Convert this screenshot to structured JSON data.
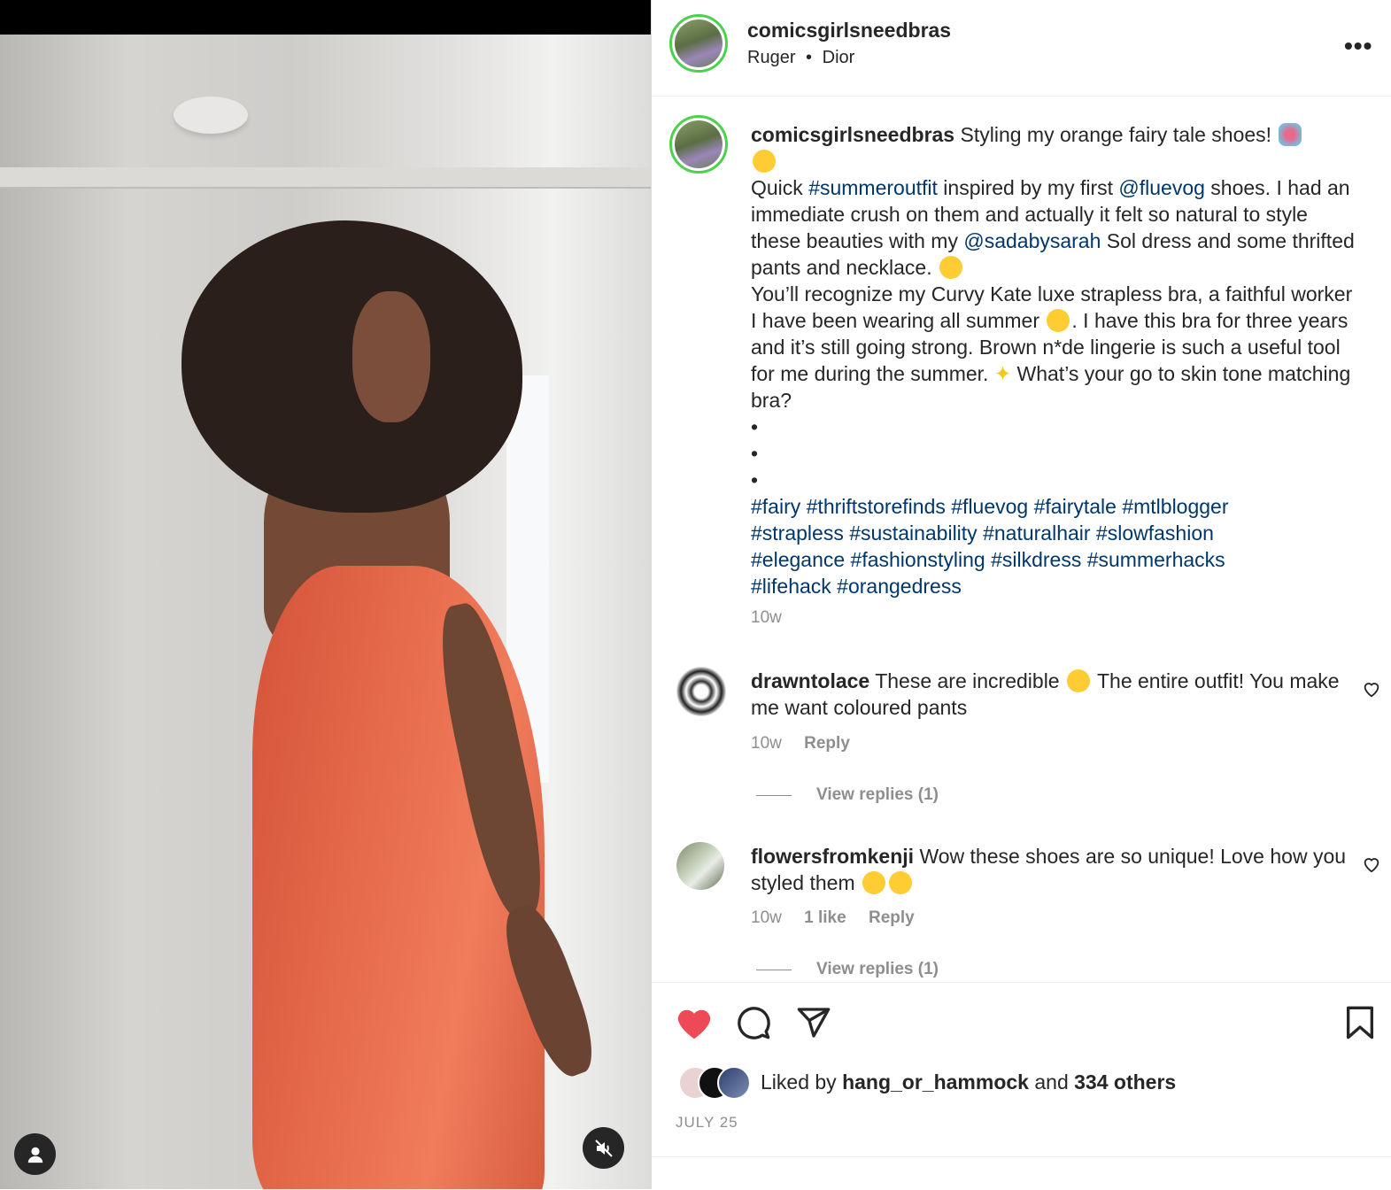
{
  "post": {
    "username": "comicsgirlsneedbras",
    "location_1": "Ruger",
    "location_2": "Dior"
  },
  "caption": {
    "username": "comicsgirlsneedbras",
    "line_1": "Styling my orange fairy tale shoes!",
    "text_a": "Quick ",
    "tag_summeroutfit": "#summeroutfit",
    "text_b": " inspired by my first ",
    "mention_fluevog": "@fluevog",
    "text_c": " shoes. I had an immediate crush on them and actually it felt so natural to style these beauties with my ",
    "mention_sadabysarah": "@sadabysarah",
    "text_d": " Sol dress and some thrifted pants and necklace.",
    "text_e": "You’ll recognize my Curvy Kate luxe strapless bra, a faithful worker I have been wearing all summer ",
    "text_f": ". I have this bra for three years and it’s still going strong. Brown n*de lingerie is such a useful tool for me during the summer. ",
    "text_g": " What’s your go to skin tone matching bra?",
    "dot": "•",
    "hashtags_1": "#fairy #thriftstorefinds #fluevog #fairytale #mtlblogger",
    "hashtags_2": "#strapless #sustainability #naturalhair #slowfashion",
    "hashtags_3": "#elegance #fashionstyling #silkdress #summerhacks",
    "hashtags_4": "#lifehack #orangedress",
    "time": "10w"
  },
  "comments": [
    {
      "username": "drawntolace",
      "text_a": "These are incredible ",
      "text_b": " The entire outfit! You make me want coloured pants",
      "time": "10w",
      "reply": "Reply",
      "view_replies": "View replies (1)"
    },
    {
      "username": "flowersfromkenji",
      "text_a": "Wow these shoes are so unique! Love how you styled them ",
      "time": "10w",
      "likes": "1 like",
      "reply": "Reply",
      "view_replies": "View replies (1)"
    }
  ],
  "likes": {
    "prefix": "Liked by ",
    "user": "hang_or_hammock",
    "middle": " and ",
    "others": "334 others"
  },
  "date": "JULY 25",
  "colors": {
    "heart_red": "#ed4956",
    "link_blue": "#00376b",
    "story_ring": "#4cd14c",
    "dress_orange": "#e66a4c"
  },
  "icons": [
    "heart-icon",
    "comment-icon",
    "share-icon",
    "bookmark-icon",
    "more-icon",
    "user-icon",
    "mute-icon"
  ]
}
